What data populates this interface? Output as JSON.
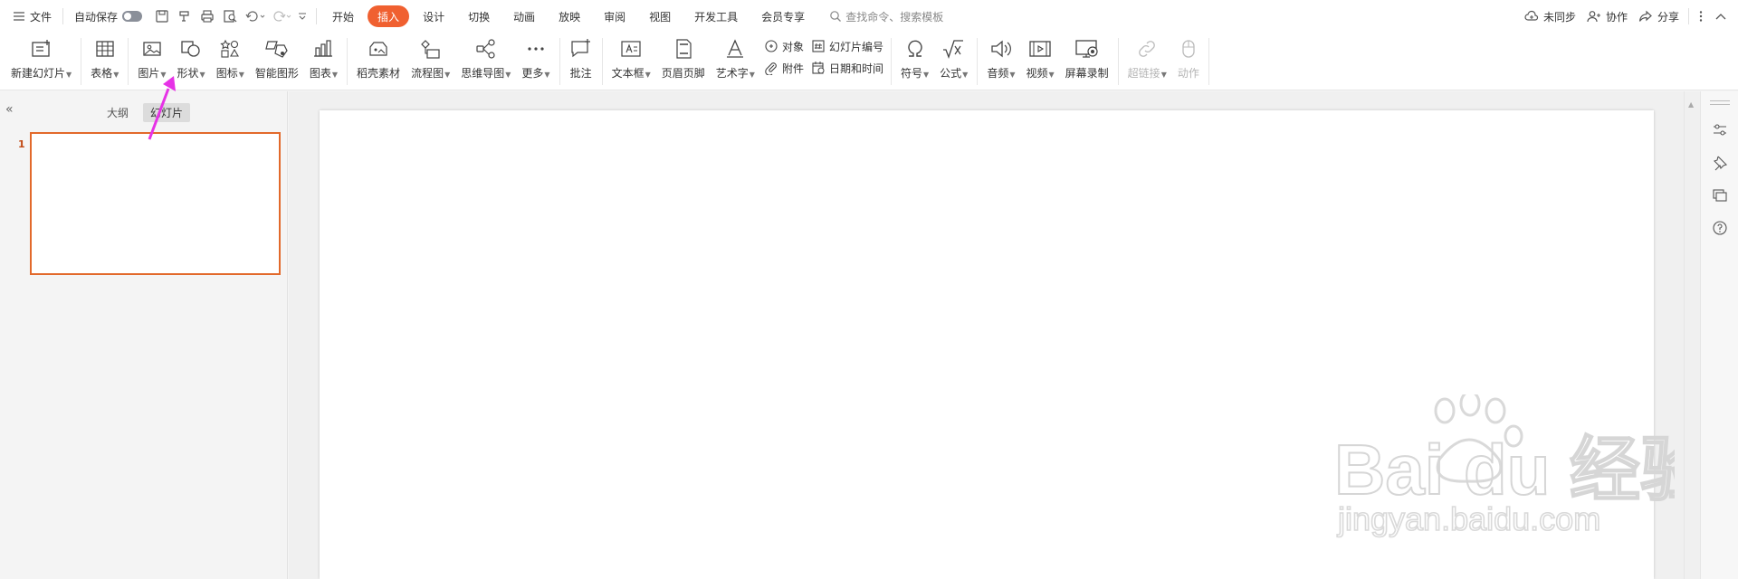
{
  "menubar": {
    "hamburger_label": "文件",
    "autosave_label": "自动保存",
    "tabs": [
      {
        "label": "开始"
      },
      {
        "label": "插入",
        "active": true
      },
      {
        "label": "设计"
      },
      {
        "label": "切换"
      },
      {
        "label": "动画"
      },
      {
        "label": "放映"
      },
      {
        "label": "审阅"
      },
      {
        "label": "视图"
      },
      {
        "label": "开发工具"
      },
      {
        "label": "会员专享"
      }
    ],
    "search_placeholder": "查找命令、搜索模板",
    "sync_label": "未同步",
    "collab_label": "协作",
    "share_label": "分享"
  },
  "ribbon": {
    "new_slide": "新建幻灯片",
    "table": "表格",
    "picture": "图片",
    "shape": "形状",
    "icon": "图标",
    "smartart": "智能图形",
    "chart": "图表",
    "docer": "稻壳素材",
    "flowchart": "流程图",
    "mindmap": "思维导图",
    "more": "更多",
    "comment": "批注",
    "textbox": "文本框",
    "header_footer": "页眉页脚",
    "wordart": "艺术字",
    "object": "对象",
    "attachment": "附件",
    "slide_number": "幻灯片编号",
    "date_time": "日期和时间",
    "symbol": "符号",
    "formula": "公式",
    "audio": "音频",
    "video": "视频",
    "screen_record": "屏幕录制",
    "hyperlink": "超链接",
    "action": "动作"
  },
  "leftpanel": {
    "tab_outline": "大纲",
    "tab_slides": "幻灯片",
    "slide_number": "1"
  },
  "colors": {
    "accent": "#f06030",
    "selection_border": "#e2692b",
    "annotation_arrow": "#e632e6"
  },
  "watermark": {
    "brand": "Bai du 经验",
    "url": "jingyan.baidu.com"
  }
}
